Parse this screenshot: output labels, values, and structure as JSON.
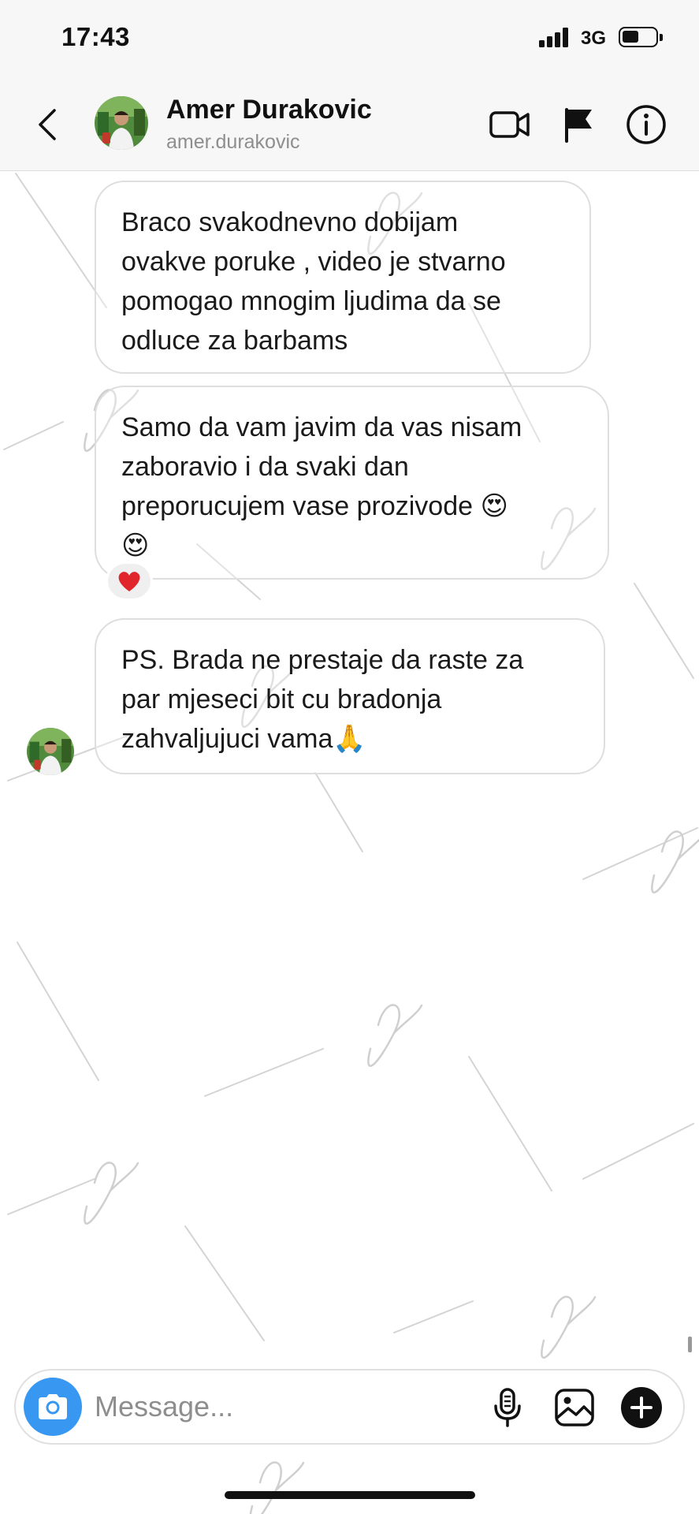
{
  "status_bar": {
    "time": "17:43",
    "network": "3G",
    "battery_level": 0.5
  },
  "header": {
    "name": "Amer Durakovic",
    "username": "amer.durakovic",
    "icons": [
      "back-chevron-icon",
      "video-camera-icon",
      "flag-icon",
      "info-icon"
    ]
  },
  "messages": [
    {
      "text": "Braco svakodnevno dobijam ovakve poruke , video je stvarno pomogao mnogim ljudima da se odluce za barbams",
      "lines": [
        "Braco svakodnevno dobijam",
        "ovakve poruke , video je stvarno",
        "pomogao mnogim ljudima da se",
        "odluce za barbams"
      ]
    },
    {
      "text": "Samo da vam  javim da vas nisam zaboravio i da svaki dan preporucujem vase prozivode 😍 😍",
      "lines": [
        "Samo da vam  javim da vas nisam",
        "zaboravio i da svaki dan",
        "preporucujem vase prozivode ",
        ""
      ],
      "emoji_inline": "😍",
      "emoji_next_line": "😍",
      "reaction": "❤️"
    },
    {
      "text": "PS. Brada ne prestaje da raste za par mjeseci bit cu bradonja zahvaljujuci vama🙏",
      "lines": [
        "PS. Brada ne prestaje da raste za",
        "par mjeseci bit cu bradonja",
        "zahvaljujuci vama"
      ],
      "emoji_end": "🙏"
    }
  ],
  "composer": {
    "placeholder": "Message...",
    "icons": [
      "camera-icon",
      "microphone-icon",
      "gallery-icon",
      "plus-icon"
    ]
  },
  "colors": {
    "accent_blue": "#3897f0",
    "header_bg": "#f7f7f7",
    "bubble_border": "#dedede",
    "muted_text": "#8e8e8e"
  }
}
